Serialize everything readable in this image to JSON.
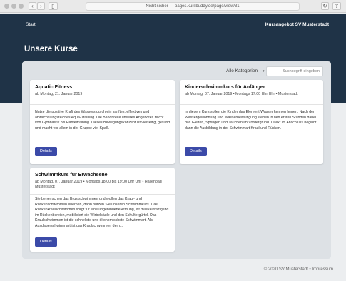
{
  "browser": {
    "url": "Nicht sicher — pages.kursbuddy.de/page/view/31"
  },
  "nav": {
    "start": "Start",
    "brand": "Kursangebot SV Musterstadt"
  },
  "page_title": "Unsere Kurse",
  "filter": {
    "category": "Alle Kategorien",
    "search_placeholder": "Suchbegriff eingeben"
  },
  "courses": [
    {
      "title": "Aquatic Fitness",
      "meta": "ab Montag, 21. Januar 2019",
      "description": "Nutze die positive Kraft des Wassers durch ein sanftes, effektives und abwechslungsreiches Aqua-Training. Die Bandbreite unseres Angebotes reicht von Gymnastik bis Hanteltraining. Dieses Bewegungskonzept ist vielseitig, gesund und macht vor allem in der Gruppe viel Spaß.",
      "button": "Details"
    },
    {
      "title": "Kinderschwimmkurs für Anfänger",
      "meta": "ab Montag, 07. Januar 2019 • Montags 17:00 Uhr Uhr • Musterstadt",
      "description": "In diesem Kurs sollen die Kinder das Element Wasser kennen lernen. Nach der Wassergewöhnung und Wasserbewältigung stehen in den ersten Stunden dabei das Gleiten, Springen und Tauchen im Vordergrund. Direkt im Anschluss beginnt dann die Ausbildung in der Schwimmart Kraul und Rücken.",
      "button": "Details"
    },
    {
      "title": "Schwimmkurs für Erwachsene",
      "meta": "ab Montag, 07. Januar 2019 • Montags 18:00 bis 19:00 Uhr Uhr • Hallenbad Musterstadt",
      "description": "Sie beherrschen das Brustschwimmen und wollen das Kraul- und Rückenschwimmen erlernen, dann nutzen Sie unseren Schwimmkurs. Das Rückenkraulschwimmen sorgt für eine ungehinderte Atmung, ist muskelkräftigend im Rückenbereich, mobilisiert die Wirbelsäule und den Schultergürtel. Das Kraulschwimmen ist die schnellste und ökonomischste Schwimmart. Als Ausdauerschwimmart ist das Kraulschwimmen dem...",
      "button": "Details"
    }
  ],
  "footer": "© 2020 SV Musterstadt • Impressum"
}
